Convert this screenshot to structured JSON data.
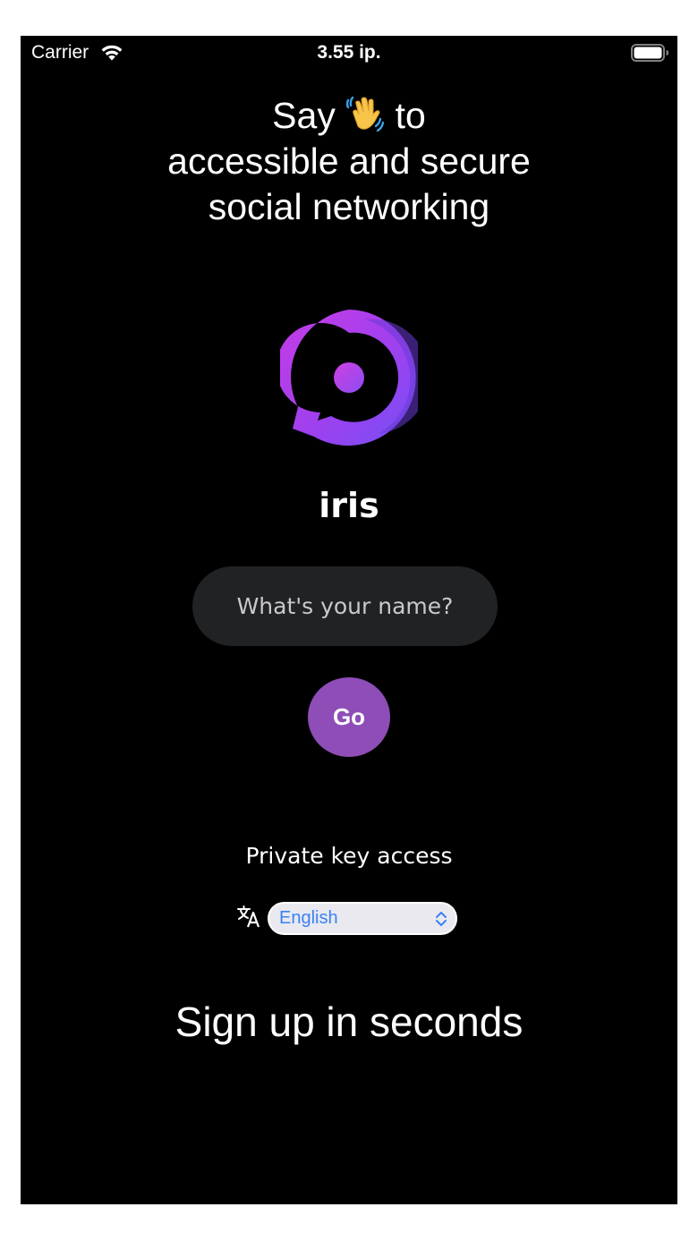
{
  "status_bar": {
    "carrier": "Carrier",
    "time": "3.55 ip.",
    "wifi_icon": "wifi-icon",
    "battery_icon": "battery-full-icon"
  },
  "headline": {
    "before_emoji": "Say ",
    "emoji_icon": "waving-hand-icon",
    "after_emoji": " to",
    "rest": "accessible and secure social networking"
  },
  "logo": {
    "icon": "iris-logo",
    "gradient_start": "#c13be8",
    "gradient_end": "#7b4bf5",
    "dot_color": "#b94ae8"
  },
  "app_name": "iris",
  "name_input": {
    "placeholder": "What's your name?",
    "value": ""
  },
  "go_button": {
    "label": "Go",
    "color": "#8e4db7"
  },
  "private_key_link": "Private key access",
  "language": {
    "icon": "translate-icon",
    "selected": "English",
    "accent": "#3b82f6"
  },
  "signup_text": "Sign up in seconds"
}
